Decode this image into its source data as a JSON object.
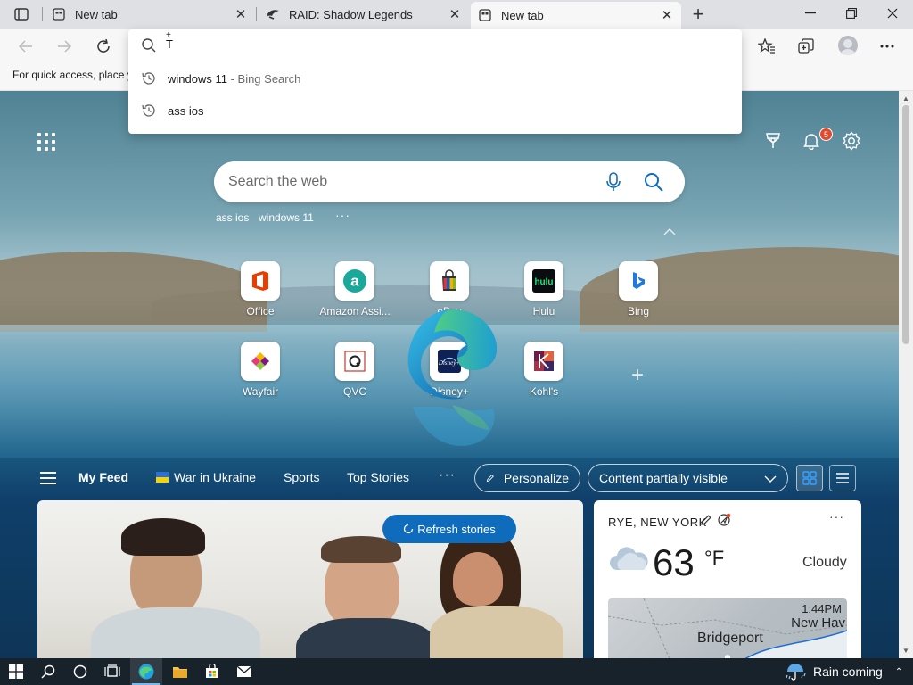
{
  "tabs": [
    {
      "title": "New tab",
      "active": false
    },
    {
      "title": "RAID: Shadow Legends",
      "active": false
    },
    {
      "title": "New tab",
      "active": true
    }
  ],
  "favorites_bar": {
    "hint": "For quick access, place y"
  },
  "omnibox": {
    "typed_text": "T",
    "suggestions": [
      {
        "text": "windows 11",
        "sub": " - Bing Search"
      },
      {
        "text": "ass ios",
        "sub": ""
      }
    ]
  },
  "notifications": {
    "count": "5"
  },
  "search": {
    "placeholder": "Search the web",
    "recent": [
      "ass ios",
      "windows 11"
    ],
    "more": "···"
  },
  "quick_links": [
    {
      "label": "Office",
      "icon": "office-icon"
    },
    {
      "label": "Amazon Assi...",
      "icon": "amazon-icon"
    },
    {
      "label": "eBay",
      "icon": "ebay-icon"
    },
    {
      "label": "Hulu",
      "icon": "hulu-icon"
    },
    {
      "label": "Bing",
      "icon": "bing-icon"
    },
    {
      "label": "Wayfair",
      "icon": "wayfair-icon"
    },
    {
      "label": "QVC",
      "icon": "qvc-icon"
    },
    {
      "label": "Disney+",
      "icon": "disney-icon"
    },
    {
      "label": "Kohl's",
      "icon": "kohls-icon"
    }
  ],
  "feed": {
    "items": [
      "My Feed",
      "War in Ukraine",
      "Sports",
      "Top Stories"
    ],
    "more": "···",
    "personalize": "Personalize",
    "visibility": "Content partially visible",
    "refresh": "Refresh stories"
  },
  "weather": {
    "location": "RYE, NEW YORK",
    "temperature": "63",
    "unit": "°F",
    "condition": "Cloudy",
    "map_time": "1:44PM",
    "map_city_1": "New Hav",
    "map_city_2": "Bridgeport",
    "more": "···"
  },
  "taskbar": {
    "weather_text": "Rain coming"
  },
  "colors": {
    "accent": "#0f6cbd",
    "taskbar": "#17222b",
    "badge": "#e04a2a"
  }
}
